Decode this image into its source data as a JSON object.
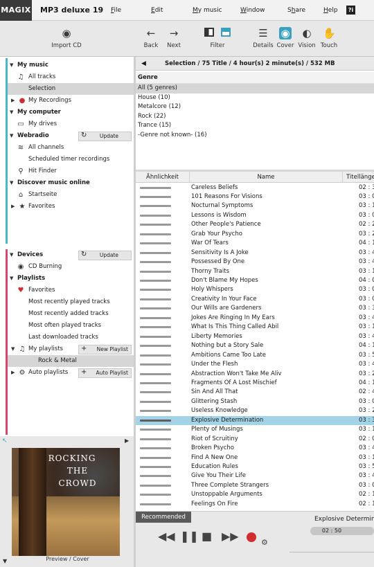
{
  "menubar": {
    "logo": "MAGIX",
    "app_title": "MP3 deluxe 19",
    "menus": [
      {
        "pre": "",
        "u": "F",
        "post": "ile"
      },
      {
        "pre": "",
        "u": "E",
        "post": "dit"
      },
      {
        "pre": "",
        "u": "M",
        "post": "y music"
      },
      {
        "pre": "",
        "u": "W",
        "post": "indow"
      },
      {
        "pre": "S",
        "u": "h",
        "post": "are"
      },
      {
        "pre": "",
        "u": "H",
        "post": "elp"
      }
    ],
    "help_icon_glyph": "?i"
  },
  "toolbar": {
    "import_cd": "Import CD",
    "back": "Back",
    "next": "Next",
    "filter": "Filter",
    "details": "Details",
    "cover": "Cover",
    "vision": "Vision",
    "touch": "Touch"
  },
  "left": {
    "my_music": "My music",
    "all_tracks": "All tracks",
    "selection": "Selection",
    "my_recordings": "My Recordings",
    "my_computer": "My computer",
    "my_drives": "My drives",
    "webradio": "Webradio",
    "update": "Update",
    "all_channels": "All channels",
    "scheduled": "Scheduled timer recordings",
    "hit_finder": "Hit Finder",
    "discover": "Discover music online",
    "startseite": "Startseite",
    "favorites": "Favorites",
    "devices": "Devices",
    "cd_burning": "CD Burning",
    "playlists": "Playlists",
    "pl_favorites": "Favorites",
    "most_recently_played": "Most recently played tracks",
    "most_recently_added": "Most recently added tracks",
    "most_often_played": "Most often played tracks",
    "last_downloaded": "Last downloaded tracks",
    "my_playlists": "My playlists",
    "new_playlist": "New Playlist",
    "rock_metal": "Rock & Metal",
    "auto_playlists": "Auto playlists",
    "auto_playlist_btn": "Auto Playlist"
  },
  "preview": {
    "label": "Preview / Cover",
    "cover_line1": "ROCKING",
    "cover_line2": "THE",
    "cover_line3": "CROWD"
  },
  "breadcrumb": "Selection  /  75 Title  /  4 hour(s) 2 minute(s)  /  532 MB",
  "genre": {
    "header": "Genre",
    "items": [
      "All (5 genres)",
      "House  (10)",
      "Metalcore  (12)",
      "Rock  (22)",
      "Trance  (15)",
      "-Genre not known-  (16)"
    ]
  },
  "table": {
    "col_similarity": "Ähnlichkeit",
    "col_name": "Name",
    "col_length": "Titellänge",
    "rows": [
      {
        "name": "Careless Beliefs",
        "len": "02 : 3"
      },
      {
        "name": "101 Reasons For Visions",
        "len": "03 : 0"
      },
      {
        "name": "Nocturnal Symptoms",
        "len": "03 : 1"
      },
      {
        "name": "Lessons is Wisdom",
        "len": "03 : 0"
      },
      {
        "name": "Other People's Patience",
        "len": "02 : 2"
      },
      {
        "name": "Grab Your Psycho",
        "len": "03 : 2"
      },
      {
        "name": "War Of Tears",
        "len": "04 : 1"
      },
      {
        "name": "Sensitivity Is A Joke",
        "len": "03 : 4"
      },
      {
        "name": "Possessed By One",
        "len": "03 : 4"
      },
      {
        "name": "Thorny Traits",
        "len": "03 : 1"
      },
      {
        "name": "Don't Blame My Hopes",
        "len": "04 : 0"
      },
      {
        "name": "Holy Whispers",
        "len": "03 : 0"
      },
      {
        "name": "Creativity In Your Face",
        "len": "03 : 0"
      },
      {
        "name": "Our Wills are Gardeners",
        "len": "03 : 3"
      },
      {
        "name": "Jokes Are Ringing In My Ears",
        "len": "03 : 4"
      },
      {
        "name": "What Is This Thing Called Abil",
        "len": "03 : 1"
      },
      {
        "name": "Liberty Memories",
        "len": "03 : 4"
      },
      {
        "name": "Nothing but a Story Sale",
        "len": "04 : 1"
      },
      {
        "name": "Ambitions Came Too Late",
        "len": "03 : 5"
      },
      {
        "name": "Under the Flesh",
        "len": "03 : 4"
      },
      {
        "name": "Abstraction Won't Take Me Aliv",
        "len": "03 : 2"
      },
      {
        "name": "Fragments Of A Lost Mischief",
        "len": "04 : 1"
      },
      {
        "name": "Sin And All That",
        "len": "02 : 4"
      },
      {
        "name": "Glittering Stash",
        "len": "03 : 0"
      },
      {
        "name": "Useless Knowledge",
        "len": "03 : 2"
      },
      {
        "name": "Explosive Determination",
        "len": "03 : 3"
      },
      {
        "name": "Plenty of Musings",
        "len": "03 : 1"
      },
      {
        "name": "Riot of Scruitiny",
        "len": "02 : 0"
      },
      {
        "name": "Broken Psycho",
        "len": "03 : 4"
      },
      {
        "name": "Find A New One",
        "len": "03 : 1"
      },
      {
        "name": "Education Rules",
        "len": "03 : 5"
      },
      {
        "name": "Give You Their Life",
        "len": "03 : 4"
      },
      {
        "name": "Three Complete Strangers",
        "len": "03 : 0"
      },
      {
        "name": "Unstoppable Arguments",
        "len": "02 : 1"
      },
      {
        "name": "Feelings On Fire",
        "len": "02 : 1"
      }
    ],
    "selected_index": 25
  },
  "player": {
    "recommended": "Recommended",
    "now_playing": "Explosive Determination",
    "position": "02 : 50"
  },
  "colors": {
    "music_section_accent": "#49b7c4",
    "devices_section_accent": "#d5476d",
    "selected_row": "#a3d3e6",
    "record_button": "#d12d30"
  }
}
